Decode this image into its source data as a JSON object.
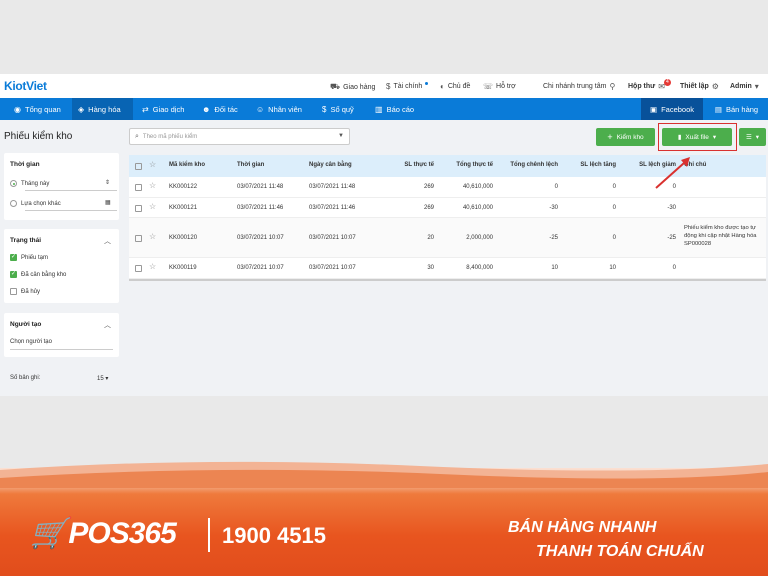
{
  "header": {
    "logo": "KiotViet",
    "links": {
      "delivery": "Giao hàng",
      "finance": "Tài chính",
      "theme": "Chủ đề",
      "support": "Hỗ trợ",
      "branch": "Chi nhánh trung tâm",
      "inbox": "Hộp thư",
      "inbox_count": "4",
      "settings": "Thiết lập",
      "user": "Admin"
    }
  },
  "nav": {
    "items": [
      "Tổng quan",
      "Hàng hóa",
      "Giao dịch",
      "Đối tác",
      "Nhân viên",
      "Sổ quỹ",
      "Báo cáo"
    ],
    "facebook": "Facebook",
    "sell": "Bán hàng"
  },
  "page": {
    "title": "Phiếu kiểm kho",
    "search_placeholder": "Theo mã phiếu kiểm",
    "add_button": "Kiểm kho",
    "export_button": "Xuất file"
  },
  "filters": {
    "time": {
      "title": "Thời gian",
      "option1": "Tháng này",
      "option2": "Lựa chọn khác"
    },
    "status": {
      "title": "Trạng thái",
      "options": [
        "Phiếu tạm",
        "Đã cân bằng kho",
        "Đã hủy"
      ],
      "checked": [
        true,
        true,
        false
      ]
    },
    "creator": {
      "title": "Người tạo",
      "placeholder": "Chọn người tạo"
    },
    "rows_label": "Số bản ghi:",
    "rows_value": "15"
  },
  "table": {
    "headers": [
      "Mã kiểm kho",
      "Thời gian",
      "Ngày cân bằng",
      "SL thực tế",
      "Tổng thực tế",
      "Tổng chênh lệch",
      "SL lệch tăng",
      "SL lệch giảm",
      "Ghi chú"
    ],
    "rows": [
      [
        "KK000122",
        "03/07/2021 11:48",
        "03/07/2021 11:48",
        "269",
        "40,610,000",
        "0",
        "0",
        "0",
        ""
      ],
      [
        "KK000121",
        "03/07/2021 11:46",
        "03/07/2021 11:46",
        "269",
        "40,610,000",
        "-30",
        "0",
        "-30",
        ""
      ],
      [
        "KK000120",
        "03/07/2021 10:07",
        "03/07/2021 10:07",
        "20",
        "2,000,000",
        "-25",
        "0",
        "-25",
        "Phiếu kiểm kho được tạo tự động khi cập nhật Hàng hóa SP000028"
      ],
      [
        "KK000119",
        "03/07/2021 10:07",
        "03/07/2021 10:07",
        "30",
        "8,400,000",
        "10",
        "10",
        "0",
        ""
      ]
    ]
  },
  "banner": {
    "brand": "POS365",
    "phone": "1900 4515",
    "slogan1": "BÁN HÀNG NHANH",
    "slogan2": "THANH TOÁN CHUẨN"
  },
  "colors": {
    "primary": "#0a7bd8",
    "green": "#4cae4c",
    "highlight": "#d9312f",
    "banner": "#e8551f"
  }
}
